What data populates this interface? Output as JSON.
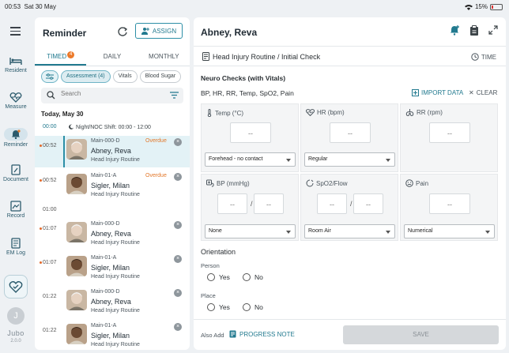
{
  "status_bar": {
    "time": "00:53",
    "date": "Sat 30 May",
    "battery": "15%",
    "battery_level": 0.15
  },
  "nav": {
    "items": [
      {
        "label": "Resident",
        "icon": "bed-icon"
      },
      {
        "label": "Measure",
        "icon": "heart-pulse-icon"
      },
      {
        "label": "Reminder",
        "icon": "bell-icon"
      },
      {
        "label": "Document",
        "icon": "document-edit-icon"
      },
      {
        "label": "Record",
        "icon": "record-icon"
      },
      {
        "label": "EM Log",
        "icon": "log-icon"
      }
    ],
    "avatar_initial": "J",
    "logo": "Jubo",
    "version": "2.0.0"
  },
  "reminder": {
    "title": "Reminder",
    "assign_label": "ASSIGN",
    "tabs": [
      {
        "label": "TIMED",
        "badge": "4"
      },
      {
        "label": "DAILY"
      },
      {
        "label": "MONTHLY"
      }
    ],
    "chips": [
      "Assessment (4)",
      "Vitals",
      "Blood Sugar"
    ],
    "search_placeholder": "Search",
    "day_label": "Today, May 30",
    "shift": {
      "time": "00:00",
      "label": "Night/NOC Shift: 00:00 - 12:00"
    },
    "hour_label": "01:00",
    "rows": [
      {
        "time": "00:52",
        "room": "Main-000-D",
        "name": "Abney, Reva",
        "routine": "Head Injury Routine",
        "status": "Overdue"
      },
      {
        "time": "00:52",
        "room": "Main-01-A",
        "name": "Sigler, Milan",
        "routine": "Head Injury Routine",
        "status": "Overdue"
      },
      {
        "time": "01:07",
        "room": "Main-000-D",
        "name": "Abney, Reva",
        "routine": "Head Injury Routine",
        "status": ""
      },
      {
        "time": "01:07",
        "room": "Main-01-A",
        "name": "Sigler, Milan",
        "routine": "Head Injury Routine",
        "status": ""
      },
      {
        "time": "01:22",
        "room": "Main-000-D",
        "name": "Abney, Reva",
        "routine": "Head Injury Routine",
        "status": ""
      },
      {
        "time": "01:22",
        "room": "Main-01-A",
        "name": "Sigler, Milan",
        "routine": "Head Injury Routine",
        "status": ""
      }
    ]
  },
  "detail": {
    "patient_name": "Abney, Reva",
    "routine": "Head Injury Routine / Initial Check",
    "time_label": "TIME",
    "section_title": "Neuro Checks (with Vitals)",
    "vitals_line": "BP, HR, RR, Temp, SpO2, Pain",
    "import_label": "IMPORT DATA",
    "clear_label": "CLEAR",
    "cards": {
      "temp": {
        "label": "Temp (°C)",
        "value": "-- ",
        "select": "Forehead - no contact"
      },
      "hr": {
        "label": "HR (bpm)",
        "value": "-- ",
        "select": "Regular"
      },
      "rr": {
        "label": "RR (rpm)",
        "value": "-- "
      },
      "bp": {
        "label": "BP (mmHg)",
        "value1": "-- ",
        "value2": "-- ",
        "select": "None"
      },
      "spo2": {
        "label": "SpO2/Flow",
        "value1": "-- ",
        "value2": "-- ",
        "select": "Room Air"
      },
      "pain": {
        "label": "Pain",
        "value": "-- ",
        "select": "Numerical"
      }
    },
    "slash": "/",
    "orientation_title": "Orientation",
    "person_label": "Person",
    "place_label": "Place",
    "yes": "Yes",
    "no": "No",
    "also_add": "Also Add",
    "progress_note": "PROGRESS NOTE",
    "save": "SAVE"
  },
  "colors": {
    "accent": "#227a8f",
    "overdue": "#e3782a",
    "selected_row": "#e3f2f6"
  }
}
